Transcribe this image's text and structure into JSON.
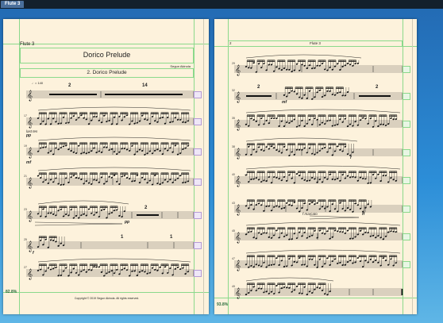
{
  "tab": {
    "label": "Flute 3"
  },
  "page1": {
    "part_name": "Flute 3",
    "title": "Dorico Prelude",
    "composer": "Segun Akinola",
    "subtitle": "2. Dorico Prelude",
    "tempo": "♩= 140",
    "multirest_1": "2",
    "multirest_2": "14",
    "expression": "last tes",
    "dyn_pp_1": "pp",
    "dyn_mf": "mf",
    "dyn_pp_2": "pp",
    "multirest_3": "2",
    "dyn_f": "f",
    "rest_1": "1",
    "rest_2": "1",
    "measure_numbers": [
      "1",
      "17",
      "19",
      "21",
      "23",
      "25",
      "27"
    ],
    "copyright": "Copyright © 2019 Segun Akinola. All rights reserved.",
    "zoom": "82.8%"
  },
  "page2": {
    "page_number": "2",
    "part_header": "Flute 3",
    "dyn_mf": "mf",
    "dyn_f": "f",
    "dyn_f_marcato": "f marcato",
    "dyn_ff": "ff",
    "multirest_1": "2",
    "multirest_2": "2",
    "measure_numbers": [
      "29",
      "32",
      "35",
      "38",
      "40",
      "43",
      "45",
      "47",
      "49"
    ],
    "zoom": "93.8%"
  },
  "colors": {
    "accent_green": "#8bd98b",
    "page_bg": "#fdf2dc",
    "view_top": "#236bb4",
    "view_bottom": "#5fb6e6"
  }
}
